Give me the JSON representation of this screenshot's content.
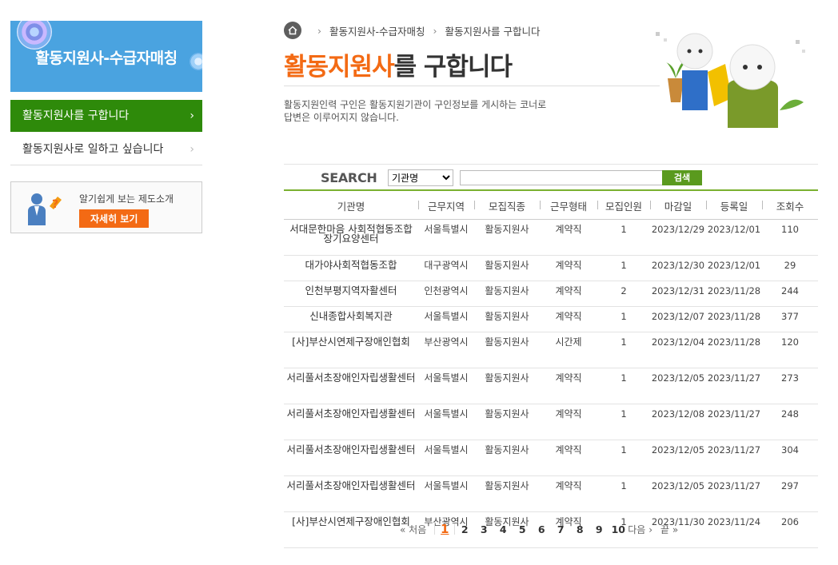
{
  "sidebar": {
    "banner_title": "활동지원사-수급자매칭",
    "menu": [
      {
        "label": "활동지원사를 구합니다",
        "active": true
      },
      {
        "label": "활동지원사로 일하고 싶습니다",
        "active": false
      }
    ],
    "intro": {
      "text": "알기쉽게 보는 제도소개",
      "button": "자세히 보기"
    }
  },
  "breadcrumb": [
    "활동지원사-수급자매칭",
    "활동지원사를 구합니다"
  ],
  "page_title": {
    "highlight": "활동지원사",
    "rest": "를 구합니다"
  },
  "description": [
    "활동지원인력 구인은 활동지원기관이 구인정보를 게시하는 코너로",
    "답변은 이루어지지 않습니다."
  ],
  "search": {
    "label": "SEARCH",
    "select_value": "기관명",
    "input_value": "",
    "button": "검색"
  },
  "table": {
    "headers": [
      "기관명",
      "근무지역",
      "모집직종",
      "근무형태",
      "모집인원",
      "마감일",
      "등록일",
      "조회수"
    ],
    "rows": [
      [
        "서대문한마음 사회적협동조합 장기요양센터",
        "서울특별시",
        "활동지원사",
        "계약직",
        "1",
        "2023/12/29",
        "2023/12/01",
        "110"
      ],
      [
        "대가야사회적협동조합",
        "대구광역시",
        "활동지원사",
        "계약직",
        "1",
        "2023/12/30",
        "2023/12/01",
        "29"
      ],
      [
        "인천부평지역자활센터",
        "인천광역시",
        "활동지원사",
        "계약직",
        "2",
        "2023/12/31",
        "2023/11/28",
        "244"
      ],
      [
        "신내종합사회복지관",
        "서울특별시",
        "활동지원사",
        "계약직",
        "1",
        "2023/12/07",
        "2023/11/28",
        "377"
      ],
      [
        "[사]부산시연제구장애인협회",
        "부산광역시",
        "활동지원사",
        "시간제",
        "1",
        "2023/12/04",
        "2023/11/28",
        "120"
      ],
      [
        "서리풀서초장애인자립생활센터",
        "서울특별시",
        "활동지원사",
        "계약직",
        "1",
        "2023/12/05",
        "2023/11/27",
        "273"
      ],
      [
        "서리풀서초장애인자립생활센터",
        "서울특별시",
        "활동지원사",
        "계약직",
        "1",
        "2023/12/08",
        "2023/11/27",
        "248"
      ],
      [
        "서리풀서초장애인자립생활센터",
        "서울특별시",
        "활동지원사",
        "계약직",
        "1",
        "2023/12/05",
        "2023/11/27",
        "304"
      ],
      [
        "서리풀서초장애인자립생활센터",
        "서울특별시",
        "활동지원사",
        "계약직",
        "1",
        "2023/12/05",
        "2023/11/27",
        "297"
      ],
      [
        "[사]부산시연제구장애인협회",
        "부산광역시",
        "활동지원사",
        "계약직",
        "1",
        "2023/11/30",
        "2023/11/24",
        "206"
      ]
    ]
  },
  "pagination": {
    "first": "처음",
    "pages": [
      "1",
      "2",
      "3",
      "4",
      "5",
      "6",
      "7",
      "8",
      "9",
      "10"
    ],
    "current": "1",
    "next": "다음",
    "last": "끝"
  },
  "colors": {
    "accent": "#f36a14",
    "green": "#2e8a0a",
    "banner": "#4aa3e0"
  }
}
